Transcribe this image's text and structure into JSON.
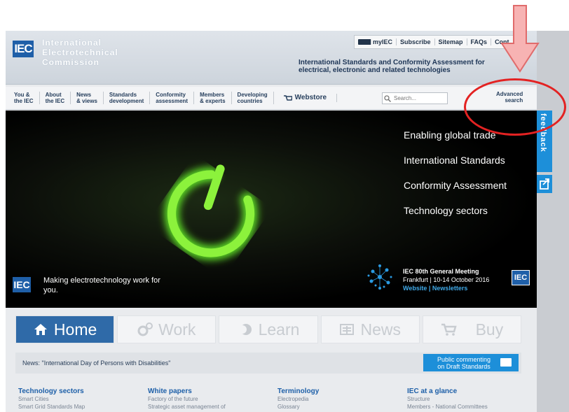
{
  "header": {
    "logo": "IEC",
    "org_lines": [
      "International",
      "Electrotechnical",
      "Commission"
    ],
    "top_links": [
      "myIEC",
      "Subscribe",
      "Sitemap",
      "FAQs",
      "Cont"
    ],
    "tagline_lines": [
      "International Standards and Conformity Assessment for",
      "electrical, electronic and related technologies"
    ]
  },
  "nav": {
    "items": [
      [
        "You &",
        "the IEC"
      ],
      [
        "About",
        "the IEC"
      ],
      [
        "News",
        "& views"
      ],
      [
        "Standards",
        "development"
      ],
      [
        "Conformity",
        "assessment"
      ],
      [
        "Members",
        "& experts"
      ],
      [
        "Developing",
        "countries"
      ]
    ],
    "webstore": "Webstore",
    "search_placeholder": "Search...",
    "advanced": [
      "Advanced",
      "search"
    ]
  },
  "hero": {
    "links": [
      "Enabling global trade",
      "International Standards",
      "Conformity Assessment",
      "Technology sectors"
    ],
    "logo": "IEC",
    "tag": "Making electrotechnology work for you.",
    "meeting_title": "IEC 80th General Meeting",
    "meeting_sub": "Frankfurt | 10-14 October 2016",
    "meeting_links": "Website | Newsletters",
    "meeting_logo": "IEC"
  },
  "tabs": [
    "Home",
    "Work",
    "Learn",
    "News",
    "Buy"
  ],
  "news": {
    "text": "News: \"International Day of Persons with Disabilities\"",
    "button": [
      "Public commenting",
      "on Draft Standards"
    ]
  },
  "columns": [
    {
      "title": "Technology sectors",
      "items": [
        "Smart Cities",
        "Smart Grid Standards Map"
      ]
    },
    {
      "title": "White papers",
      "items": [
        "Factory of the future",
        "Strategic asset management of"
      ]
    },
    {
      "title": "Terminology",
      "items": [
        "Electropedia",
        "Glossary"
      ]
    },
    {
      "title": "IEC at a glance",
      "items": [
        "Structure",
        "Members - National Committees"
      ]
    }
  ],
  "feedback": "feedback",
  "colors": {
    "brand_blue": "#1f5fa8",
    "accent": "#1d8fd9",
    "annotation_red": "#e32222"
  }
}
